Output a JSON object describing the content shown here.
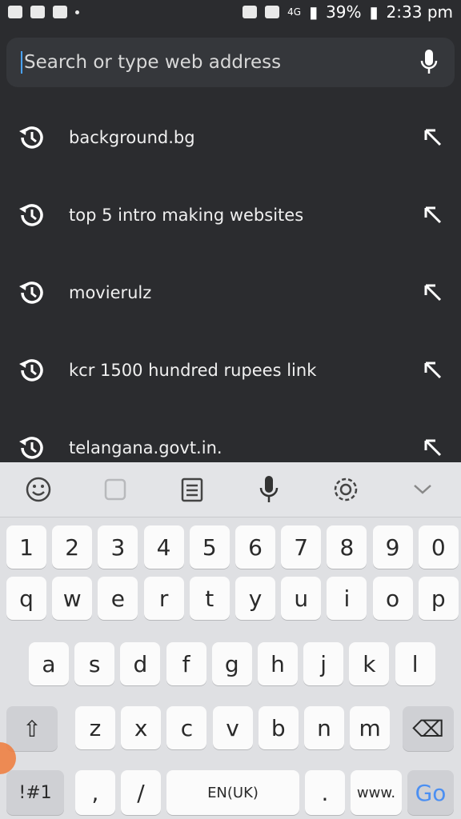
{
  "status_bar": {
    "battery": "39%",
    "signal": "4G",
    "time": "2:33 pm"
  },
  "search": {
    "placeholder": "Search or type web address"
  },
  "suggestions": [
    {
      "label": "background.bg"
    },
    {
      "label": "top 5 intro making websites"
    },
    {
      "label": "movierulz"
    },
    {
      "label": "kcr 1500 hundred rupees link"
    },
    {
      "label": "telangana.govt.in."
    }
  ],
  "keyboard": {
    "toolbar": [
      "emoji-icon",
      "sticker-icon",
      "clipboard-icon",
      "mic-icon",
      "settings-icon",
      "collapse-icon"
    ],
    "row_numbers": [
      "1",
      "2",
      "3",
      "4",
      "5",
      "6",
      "7",
      "8",
      "9",
      "0"
    ],
    "row_q": [
      "q",
      "w",
      "e",
      "r",
      "t",
      "y",
      "u",
      "i",
      "o",
      "p"
    ],
    "row_a": [
      "a",
      "s",
      "d",
      "f",
      "g",
      "h",
      "j",
      "k",
      "l"
    ],
    "row_z": [
      "z",
      "x",
      "c",
      "v",
      "b",
      "n",
      "m"
    ],
    "bottom": {
      "symbols": "!#1",
      "comma": ",",
      "slash": "/",
      "space": "EN(UK)",
      "period": ".",
      "www": "www.",
      "go": "Go"
    }
  }
}
